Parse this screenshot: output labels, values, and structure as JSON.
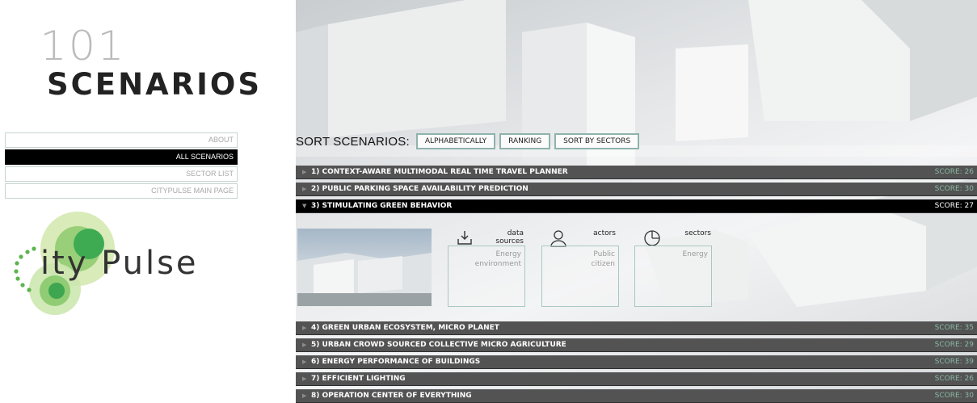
{
  "logo": {
    "number": "101",
    "word": "SCENARIOS"
  },
  "nav": [
    {
      "label": "ABOUT",
      "active": false
    },
    {
      "label": "ALL SCENARIOS",
      "active": true
    },
    {
      "label": "SECTOR LIST",
      "active": false
    },
    {
      "label": "CITYPULSE MAIN PAGE",
      "active": false
    }
  ],
  "citypulse": {
    "text": "ity Pulse"
  },
  "sort": {
    "label": "SORT SCENARIOS:",
    "buttons": [
      "ALPHABETICALLY",
      "RANKING",
      "SORT BY SECTORS"
    ]
  },
  "scenarios": [
    {
      "title": "1) CONTEXT-AWARE MULTIMODAL REAL TIME TRAVEL PLANNER",
      "score": "SCORE: 26"
    },
    {
      "title": "2) PUBLIC PARKING SPACE AVAILABILITY PREDICTION",
      "score": "SCORE: 30"
    },
    {
      "title": "3) STIMULATING GREEN BEHAVIOR",
      "score": "SCORE: 27"
    },
    {
      "title": "4) GREEN URBAN ECOSYSTEM, MICRO PLANET",
      "score": "SCORE: 35"
    },
    {
      "title": "5) URBAN CROWD SOURCED COLLECTIVE MICRO AGRICULTURE",
      "score": "SCORE: 29"
    },
    {
      "title": "6) ENERGY PERFORMANCE OF BUILDINGS",
      "score": "SCORE: 39"
    },
    {
      "title": "7) EFFICIENT LIGHTING",
      "score": "SCORE: 26"
    },
    {
      "title": "8) OPERATION CENTER OF EVERYTHING",
      "score": "SCORE: 30"
    }
  ],
  "detail": {
    "data_sources": {
      "label_line1": "data",
      "label_line2": "sources",
      "icon": "download-tray-icon",
      "value_line1": "Energy",
      "value_line2": "environment"
    },
    "actors": {
      "label": "actors",
      "icon": "person-icon",
      "value_line1": "Public",
      "value_line2": "citizen"
    },
    "sectors": {
      "label": "sectors",
      "icon": "pie-chart-icon",
      "value_line1": "Energy"
    }
  },
  "colors": {
    "accent_border": "#8fb3ac",
    "score_green": "#8ab8a5",
    "row_bg": "#535353"
  }
}
